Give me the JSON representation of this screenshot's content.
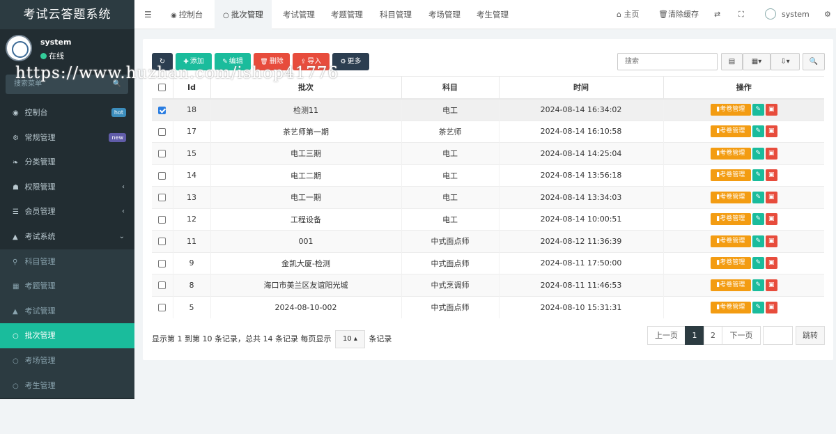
{
  "app": {
    "title": "考试云答题系统"
  },
  "user": {
    "name": "system",
    "status": "在线"
  },
  "watermark": "https://www.huzhan.com/ishop41776",
  "sidebar": {
    "search_placeholder": "搜索菜单",
    "items": [
      {
        "label": "控制台",
        "badge": "hot",
        "badge_color": "#3c8dbc"
      },
      {
        "label": "常规管理",
        "badge": "new",
        "badge_color": "#605ca8"
      },
      {
        "label": "分类管理"
      },
      {
        "label": "权限管理",
        "chevron": "‹"
      },
      {
        "label": "会员管理",
        "chevron": "‹"
      },
      {
        "label": "考试系统",
        "chevron": "⌄"
      }
    ],
    "subitems": [
      {
        "label": "科目管理"
      },
      {
        "label": "考题管理"
      },
      {
        "label": "考试管理"
      },
      {
        "label": "批次管理",
        "active": true
      },
      {
        "label": "考场管理"
      },
      {
        "label": "考生管理"
      }
    ]
  },
  "topnav": {
    "tabs": [
      {
        "label": "控制台"
      },
      {
        "label": "批次管理",
        "active": true
      },
      {
        "label": "考试管理"
      },
      {
        "label": "考题管理"
      },
      {
        "label": "科目管理"
      },
      {
        "label": "考场管理"
      },
      {
        "label": "考生管理"
      }
    ],
    "home": "主页",
    "clear_cache": "清除缓存",
    "user": "system"
  },
  "toolbar": {
    "add": "添加",
    "edit": "编辑",
    "delete": "删除",
    "import": "导入",
    "more": "更多",
    "search_placeholder": "搜索"
  },
  "table": {
    "headers": [
      "Id",
      "批次",
      "科目",
      "时间",
      "操作"
    ],
    "op_exam": "考卷管理",
    "rows": [
      {
        "id": "18",
        "batch": "检测11",
        "subject": "电工",
        "time": "2024-08-14 16:34:02",
        "checked": true
      },
      {
        "id": "17",
        "batch": "茶艺师第一期",
        "subject": "茶艺师",
        "time": "2024-08-14 16:10:58"
      },
      {
        "id": "15",
        "batch": "电工三期",
        "subject": "电工",
        "time": "2024-08-14 14:25:04"
      },
      {
        "id": "14",
        "batch": "电工二期",
        "subject": "电工",
        "time": "2024-08-14 13:56:18"
      },
      {
        "id": "13",
        "batch": "电工一期",
        "subject": "电工",
        "time": "2024-08-14 13:34:03"
      },
      {
        "id": "12",
        "batch": "工程设备",
        "subject": "电工",
        "time": "2024-08-14 10:00:51"
      },
      {
        "id": "11",
        "batch": "001",
        "subject": "中式面点师",
        "time": "2024-08-12 11:36:39"
      },
      {
        "id": "9",
        "batch": "金凯大厦-检测",
        "subject": "中式面点师",
        "time": "2024-08-11 17:50:00"
      },
      {
        "id": "8",
        "batch": "海口市美兰区友谊阳光城",
        "subject": "中式烹调师",
        "time": "2024-08-11 11:46:53"
      },
      {
        "id": "5",
        "batch": "2024-08-10-002",
        "subject": "中式面点师",
        "time": "2024-08-10 15:31:31"
      }
    ]
  },
  "pagination": {
    "info_prefix": "显示第 1 到第 10 条记录，总共 14 条记录 每页显示",
    "page_size": "10",
    "info_suffix": "条记录",
    "prev": "上一页",
    "pages": [
      "1",
      "2"
    ],
    "next": "下一页",
    "jump": "跳转"
  }
}
